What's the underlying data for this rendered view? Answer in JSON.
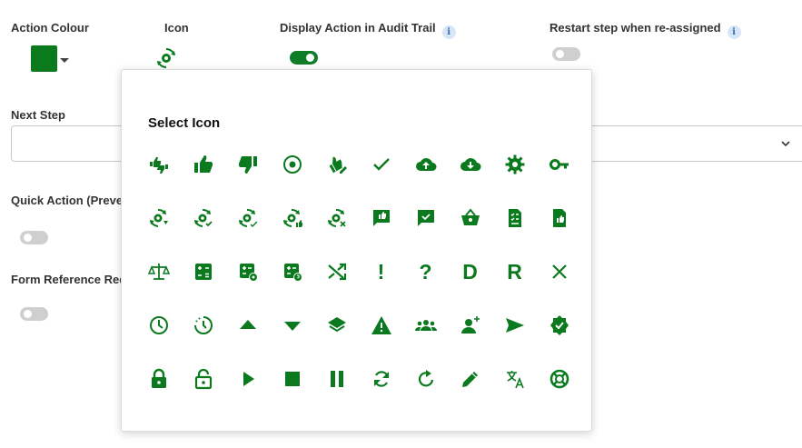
{
  "labels": {
    "action_colour": "Action Colour",
    "icon": "Icon",
    "display_action": "Display Action in Audit Trail",
    "restart_step": "Restart step when re-assigned",
    "next_step": "Next Step",
    "quick_action": "Quick Action (Preven",
    "form_reference": "Form Reference Requ"
  },
  "info_glyph": "i",
  "action_colour_value": "#0b7a1e",
  "toggles": {
    "display_action": true,
    "restart_step": false,
    "quick_action": false,
    "form_reference": false
  },
  "popup": {
    "title": "Select Icon",
    "icon_color": "#0b7a1e",
    "icons": [
      "thumbs-up-down-icon",
      "thumb-up-icon",
      "thumb-down-icon",
      "radio-button-icon",
      "thumb-edit-icon",
      "check-icon",
      "cloud-upload-icon",
      "cloud-download-icon",
      "settings-icon",
      "key-icon",
      "gear-refresh-down-icon",
      "gear-refresh-check-icon",
      "gear-refresh-check2-icon",
      "gear-refresh-like-icon",
      "gear-refresh-close-icon",
      "chat-like-icon",
      "chat-check-icon",
      "basket-icon",
      "checklist-document-icon",
      "document-like-icon",
      "scale-icon",
      "calculator-icon",
      "calculator-settings-icon",
      "calculator-help-icon",
      "shuffle-icon",
      "exclamation-icon",
      "question-icon",
      "letter-d-icon",
      "letter-r-icon",
      "close-icon",
      "clock-icon",
      "clock-dashed-icon",
      "triangle-up-icon",
      "triangle-down-icon",
      "layers-icon",
      "warning-icon",
      "group-icon",
      "add-person-icon",
      "send-icon",
      "verified-icon",
      "lock-icon",
      "lock-open-icon",
      "play-icon",
      "stop-icon",
      "pause-icon",
      "sync-icon",
      "rotate-icon",
      "pencil-icon",
      "translate-icon",
      "support-icon"
    ],
    "glyphs": {
      "exclamation-icon": "!",
      "question-icon": "?",
      "letter-d-icon": "D",
      "letter-r-icon": "R"
    }
  }
}
